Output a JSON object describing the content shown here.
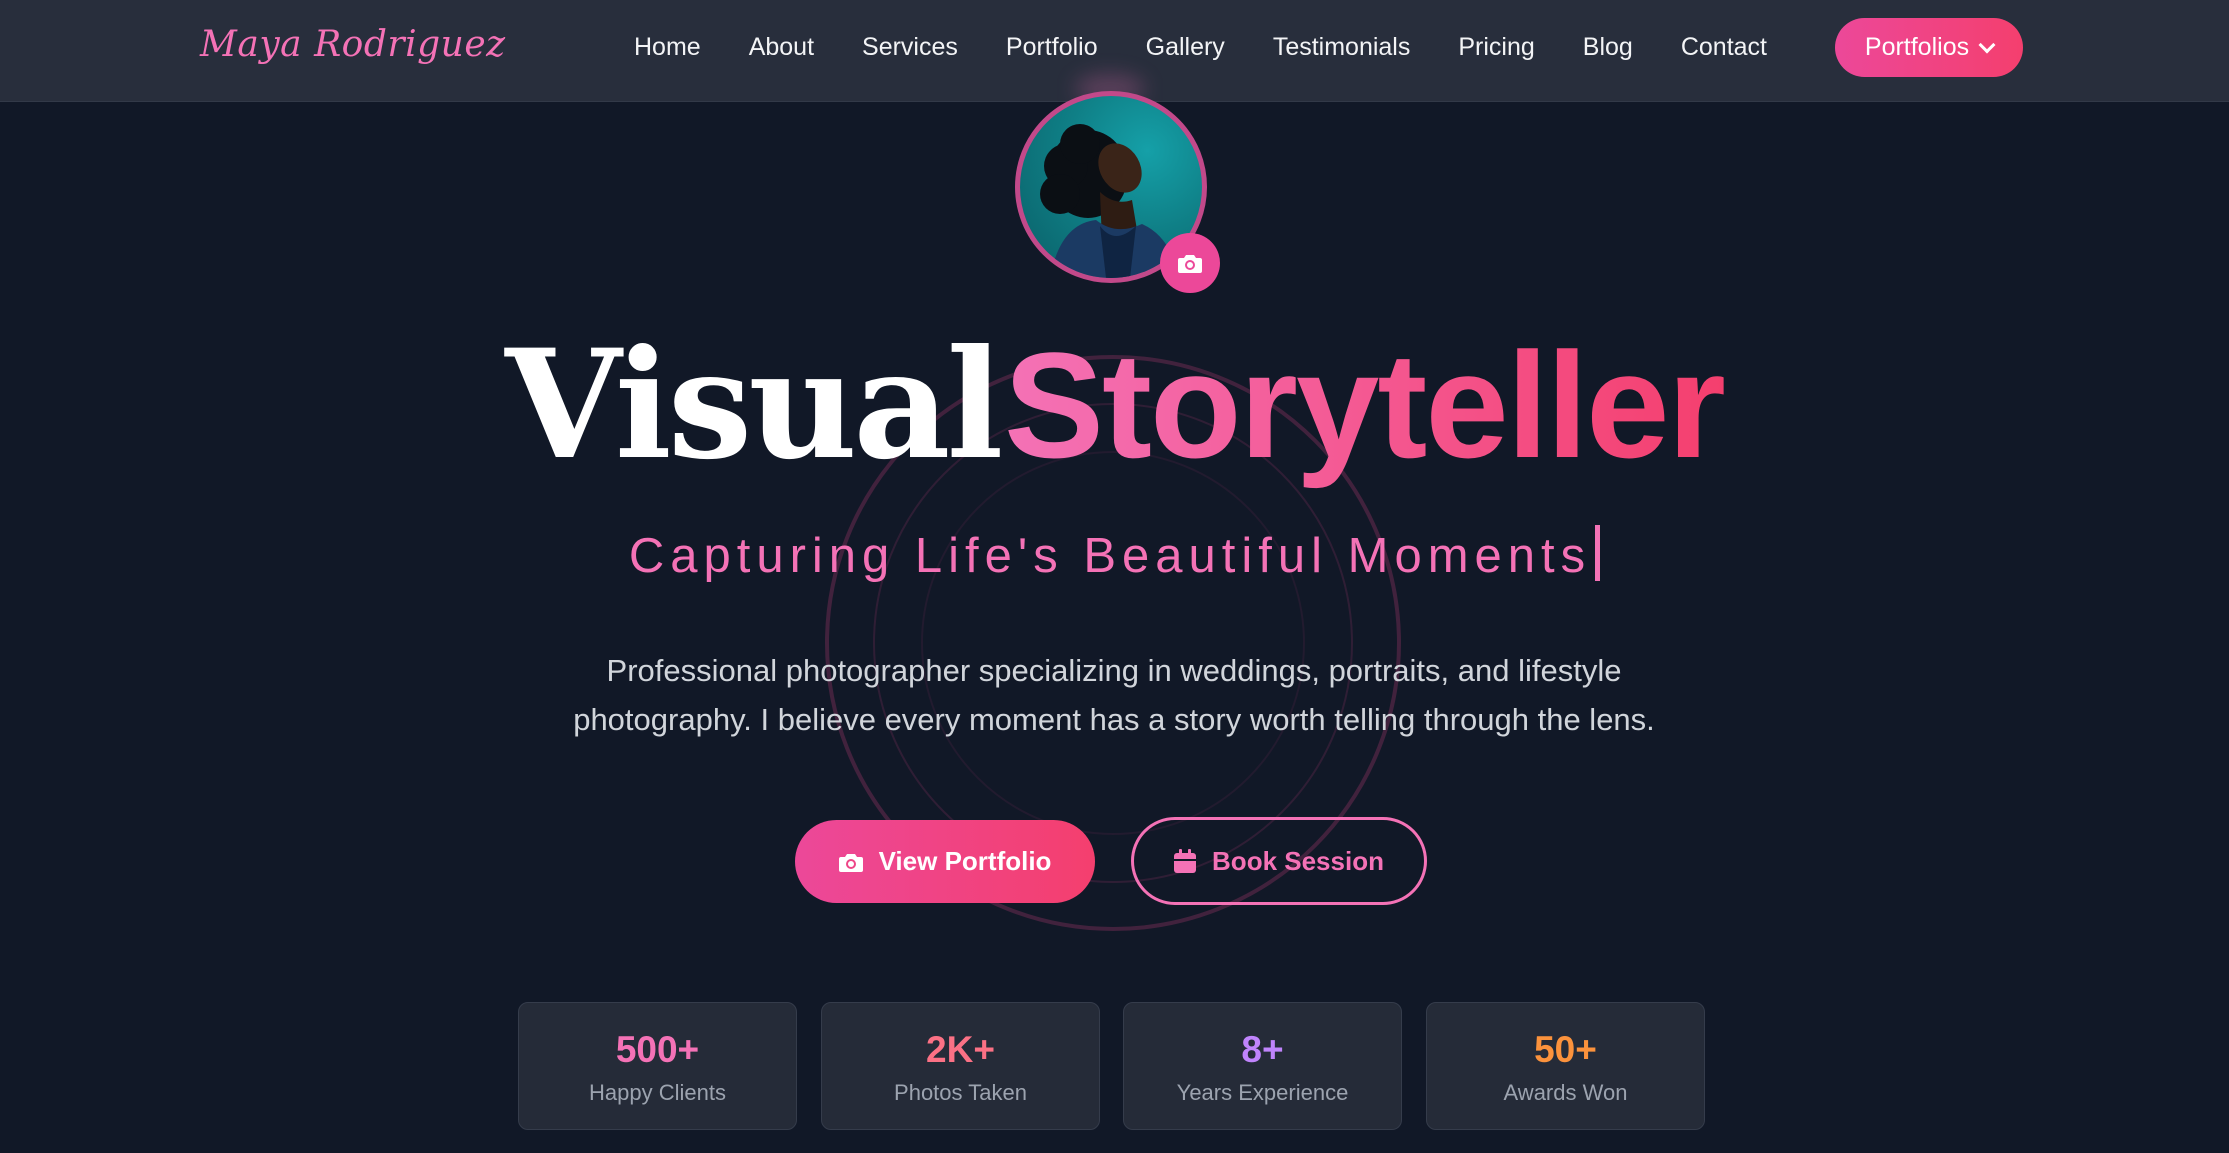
{
  "brand": {
    "logo_text": "Maya Rodriguez"
  },
  "nav": {
    "links": [
      "Home",
      "About",
      "Services",
      "Portfolio",
      "Gallery",
      "Testimonials",
      "Pricing",
      "Blog",
      "Contact"
    ],
    "cta_label": "Portfolios"
  },
  "hero": {
    "title_part1": "Visual",
    "title_part2": "Storyteller",
    "subtitle": "Capturing Life's Beautiful Moments",
    "description": "Professional photographer specializing in weddings, portraits, and lifestyle photography. I believe every moment has a story worth telling through the lens.",
    "primary_button": "View Portfolio",
    "secondary_button": "Book Session"
  },
  "stats": [
    {
      "value": "500+",
      "label": "Happy Clients",
      "color": "#f472b6"
    },
    {
      "value": "2K+",
      "label": "Photos Taken",
      "color": "#fb7185"
    },
    {
      "value": "8+",
      "label": "Years Experience",
      "color": "#c084fc"
    },
    {
      "value": "50+",
      "label": "Awards Won",
      "color": "#fb923c"
    }
  ],
  "theme": {
    "background": "#111827",
    "accent": "#ec4899",
    "accent_alt": "#f43f6e"
  },
  "icons": {
    "camera_badge": "camera-icon",
    "primary_button": "camera-icon",
    "secondary_button": "calendar-icon",
    "cta": "chevron-down-icon"
  }
}
